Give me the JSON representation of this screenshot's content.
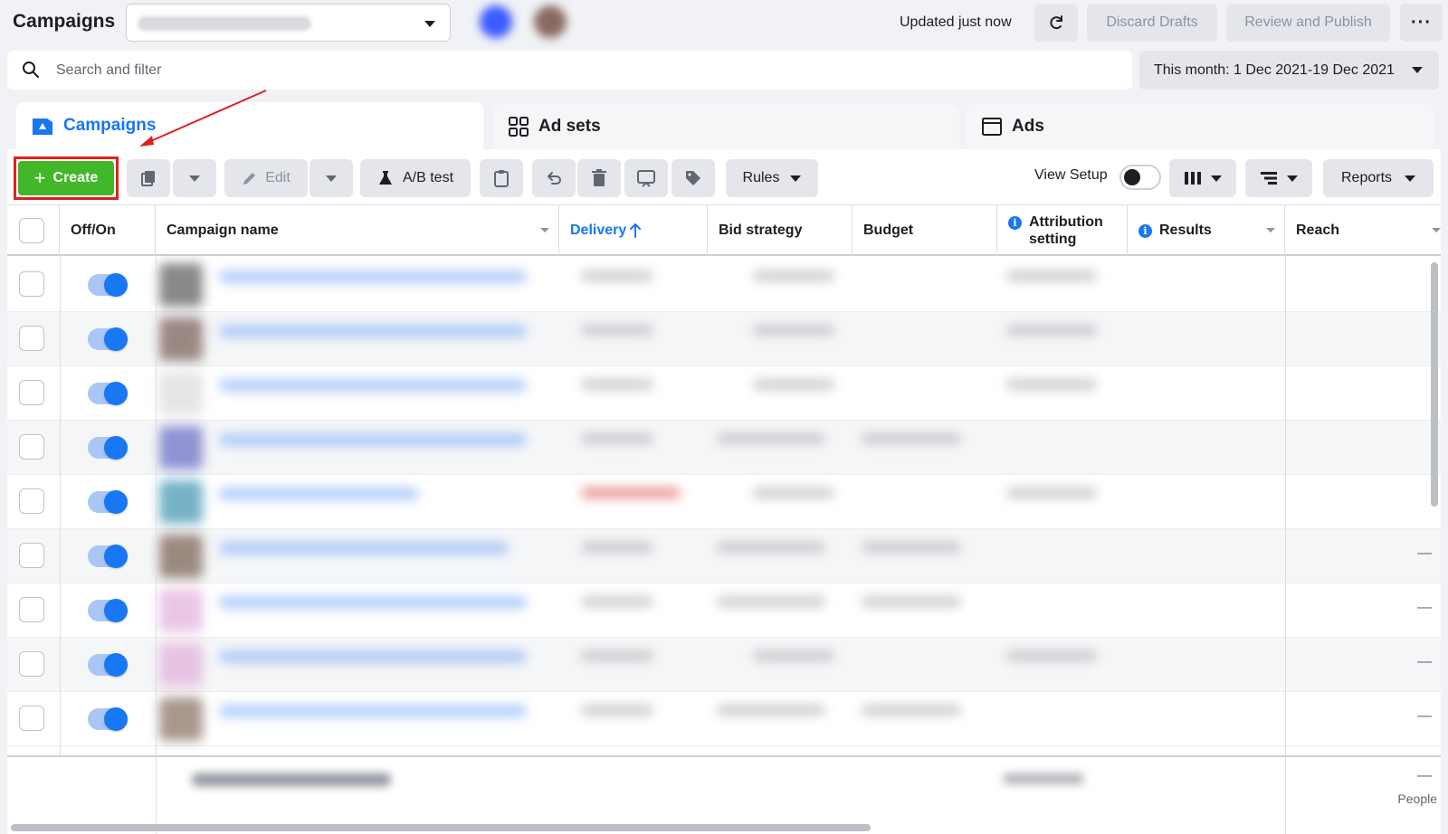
{
  "header": {
    "title": "Campaigns",
    "updated": "Updated just now",
    "discard_label": "Discard Drafts",
    "review_label": "Review and Publish",
    "more_label": "···"
  },
  "search": {
    "placeholder": "Search and filter",
    "date_range": "This month: 1 Dec 2021-19 Dec 2021"
  },
  "tabs": [
    {
      "label": "Campaigns",
      "icon": "campaign-flag-icon"
    },
    {
      "label": "Ad sets",
      "icon": "grid-icon"
    },
    {
      "label": "Ads",
      "icon": "ad-window-icon"
    }
  ],
  "toolbar": {
    "create_label": "Create",
    "edit_label": "Edit",
    "ab_test_label": "A/B test",
    "rules_label": "Rules",
    "view_setup_label": "View Setup",
    "reports_label": "Reports"
  },
  "table": {
    "columns": [
      "Off/On",
      "Campaign name",
      "Delivery",
      "Bid strategy",
      "Budget",
      "Attribution setting",
      "Results",
      "Reach"
    ],
    "rows": [
      {
        "on": true,
        "reach": ""
      },
      {
        "on": true,
        "reach": ""
      },
      {
        "on": true,
        "reach": ""
      },
      {
        "on": true,
        "reach": ""
      },
      {
        "on": true,
        "reach": ""
      },
      {
        "on": true,
        "reach": "—"
      },
      {
        "on": true,
        "reach": "—"
      },
      {
        "on": true,
        "reach": "—"
      },
      {
        "on": true,
        "reach": "—"
      }
    ],
    "footer_reach": "—",
    "footer_people": "People"
  },
  "colors": {
    "accent": "#1877f2",
    "create_green": "#42b72a",
    "highlight_red": "#e02020"
  }
}
